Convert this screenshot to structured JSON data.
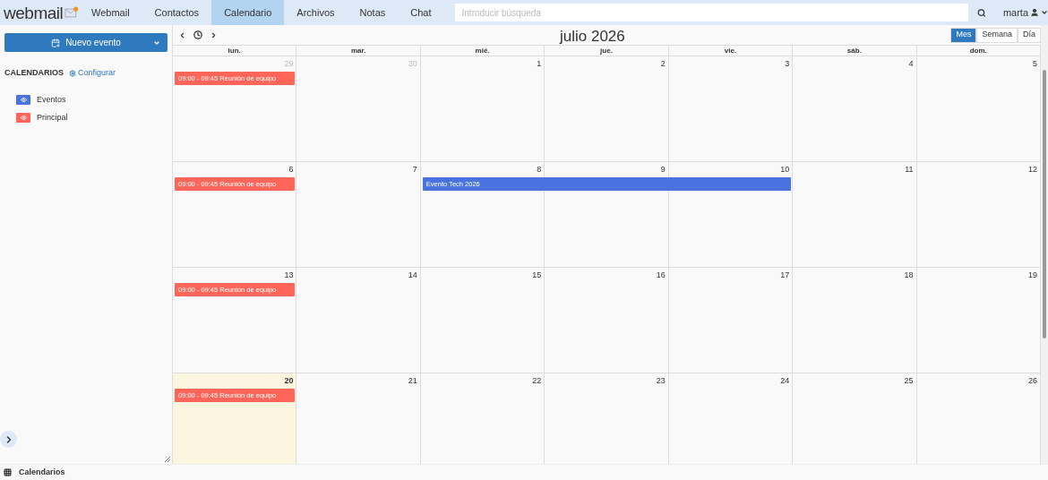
{
  "nav": {
    "logo": "webmail",
    "items": [
      {
        "label": "Webmail",
        "selected": false
      },
      {
        "label": "Contactos",
        "selected": false
      },
      {
        "label": "Calendario",
        "selected": true
      },
      {
        "label": "Archivos",
        "selected": false
      },
      {
        "label": "Notas",
        "selected": false
      },
      {
        "label": "Chat",
        "selected": false
      }
    ],
    "search": {
      "placeholder": "Introducir búsqueda"
    },
    "user": "marta"
  },
  "sidebar": {
    "new_button": "Nuevo evento",
    "heading": "CALENDARIOS",
    "configure": "Configurar",
    "calendars": [
      {
        "name": "Eventos",
        "color": "#4a73e0"
      },
      {
        "name": "Principal",
        "color": "#ff6659"
      }
    ]
  },
  "calendar": {
    "title": "julio 2026",
    "views": [
      {
        "label": "Mes",
        "selected": true
      },
      {
        "label": "Semana",
        "selected": false
      },
      {
        "label": "Día",
        "selected": false
      }
    ],
    "weekdays": [
      "lun.",
      "mar.",
      "mié.",
      "jue.",
      "vie.",
      "sáb.",
      "dom."
    ],
    "weeks": [
      {
        "days": [
          {
            "number": "29",
            "other_month": true,
            "today": false,
            "events": [
              {
                "text": "09:00 - 09:45 Reunión de equipo",
                "color": "#ff6659"
              }
            ]
          },
          {
            "number": "30",
            "other_month": true,
            "today": false
          },
          {
            "number": "1",
            "other_month": false,
            "today": false
          },
          {
            "number": "2",
            "other_month": false,
            "today": false
          },
          {
            "number": "3",
            "other_month": false,
            "today": false
          },
          {
            "number": "4",
            "other_month": false,
            "today": false
          },
          {
            "number": "5",
            "other_month": false,
            "today": false
          }
        ]
      },
      {
        "days": [
          {
            "number": "6",
            "other_month": false,
            "today": false,
            "events": [
              {
                "text": "09:00 - 09:45 Reunión de equipo",
                "color": "#ff6659"
              }
            ]
          },
          {
            "number": "7",
            "other_month": false,
            "today": false
          },
          {
            "number": "8",
            "other_month": false,
            "today": false,
            "events": [
              {
                "text": "Evento Tech 2026",
                "color": "#4a73e0"
              }
            ]
          },
          {
            "number": "9",
            "other_month": false,
            "today": false,
            "continued": true
          },
          {
            "number": "10",
            "other_month": false,
            "today": false,
            "continued": true
          },
          {
            "number": "11",
            "other_month": false,
            "today": false
          },
          {
            "number": "12",
            "other_month": false,
            "today": false
          }
        ]
      },
      {
        "days": [
          {
            "number": "13",
            "other_month": false,
            "today": false,
            "events": [
              {
                "text": "09:00 - 09:45 Reunión de equipo",
                "color": "#ff6659"
              }
            ]
          },
          {
            "number": "14",
            "other_month": false,
            "today": false
          },
          {
            "number": "15",
            "other_month": false,
            "today": false
          },
          {
            "number": "16",
            "other_month": false,
            "today": false
          },
          {
            "number": "17",
            "other_month": false,
            "today": false
          },
          {
            "number": "18",
            "other_month": false,
            "today": false
          },
          {
            "number": "19",
            "other_month": false,
            "today": false
          }
        ]
      },
      {
        "days": [
          {
            "number": "20",
            "other_month": false,
            "today": true,
            "events": [
              {
                "text": "09:00 - 09:45 Reunión de equipo",
                "color": "#ff6659"
              }
            ]
          },
          {
            "number": "21",
            "other_month": false,
            "today": false
          },
          {
            "number": "22",
            "other_month": false,
            "today": false
          },
          {
            "number": "23",
            "other_month": false,
            "today": false
          },
          {
            "number": "24",
            "other_month": false,
            "today": false
          },
          {
            "number": "25",
            "other_month": false,
            "today": false
          },
          {
            "number": "26",
            "other_month": false,
            "today": false
          }
        ]
      }
    ]
  },
  "status_bar": {
    "label": "Calendarios"
  }
}
